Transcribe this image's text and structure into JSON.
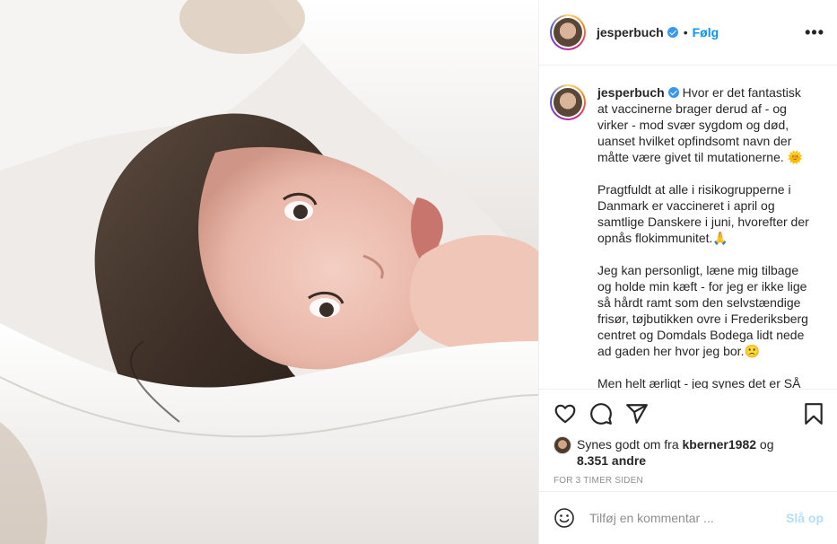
{
  "post": {
    "username": "jesperbuch",
    "follow_label": "Følg",
    "dot_separator": "•",
    "more_label": "•••"
  },
  "caption": {
    "username": "jesperbuch",
    "paragraphs": [
      "Hvor er det fantastisk at vaccinerne brager derud af - og virker - mod svær sygdom og død, uanset hvilket opfindsomt navn der måtte være givet til mutationerne. 🌞",
      "Pragtfuldt at alle i risikogrupperne i Danmark er vaccineret i april og samtlige Danskere i juni, hvorefter der opnås flokimmunitet.🙏",
      "Jeg kan personligt, læne mig tilbage og holde min kæft - for jeg er ikke lige så hårdt ramt som den selvstændige frisør, tøjbutikken ovre i Frederiksberg centret og Domdals Bodega lidt nede ad gaden her hvor jeg bor.🙁",
      "Men helt ærligt - jeg synes det er SÅ"
    ]
  },
  "likes": {
    "prefix": "Synes godt om fra",
    "liker": "kberner1982",
    "conjunction": "og",
    "others": "8.351 andre"
  },
  "timestamp": "FOR 3 TIMER SIDEN",
  "comment": {
    "placeholder": "Tilføj en kommentar ...",
    "post_label": "Slå op"
  },
  "colors": {
    "link_blue": "#0095f6",
    "verified_blue": "#3897f0",
    "post_disabled": "#b2dffc",
    "muted_text": "#8e8e8e",
    "border": "#efefef"
  },
  "icons": [
    "heart-icon",
    "comment-icon",
    "share-icon",
    "bookmark-icon",
    "emoji-icon",
    "verified-badge-icon",
    "more-options-icon"
  ]
}
